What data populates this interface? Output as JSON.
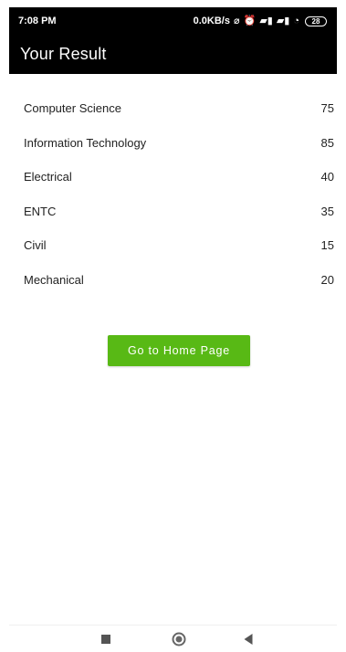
{
  "status_bar": {
    "time": "7:08 PM",
    "network_speed": "0.0KB/s",
    "battery_level": "28",
    "icons": [
      "data-saver-icon",
      "alarm-icon",
      "sim-1-signal-icon",
      "sim-2-signal-icon",
      "wifi-icon",
      "battery-icon"
    ]
  },
  "app_bar": {
    "title": "Your Result"
  },
  "results": [
    {
      "subject": "Computer Science",
      "score": "75"
    },
    {
      "subject": "Information Technology",
      "score": "85"
    },
    {
      "subject": "Electrical",
      "score": "40"
    },
    {
      "subject": "ENTC",
      "score": "35"
    },
    {
      "subject": "Civil",
      "score": "15"
    },
    {
      "subject": "Mechanical",
      "score": "20"
    }
  ],
  "actions": {
    "home_button_label": "Go to Home Page"
  },
  "navigation": {
    "icons": [
      "recent-apps-icon",
      "home-icon",
      "back-icon"
    ]
  },
  "colors": {
    "status_background": "#000000",
    "app_bar_background": "#000000",
    "primary_button": "#58b915",
    "text": "#222222",
    "background": "#ffffff"
  }
}
